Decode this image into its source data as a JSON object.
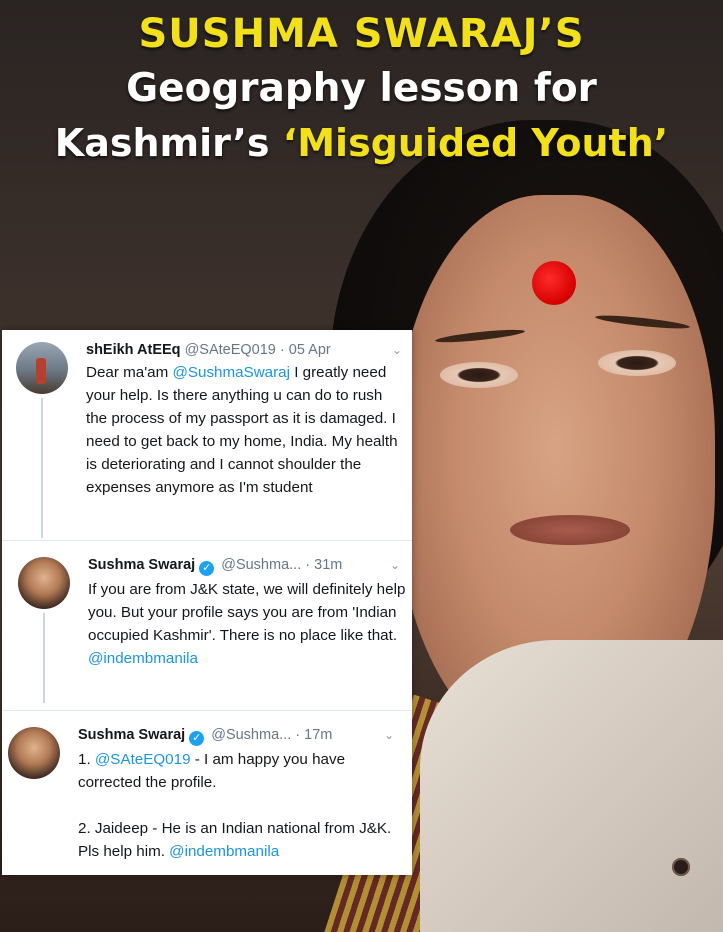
{
  "headline": {
    "line1": "SUSHMA SWARAJ’S",
    "line2": "Geography lesson for",
    "line3_prefix": "Kashmir’s",
    "line3_highlight": "‘Misguided Youth’"
  },
  "colors": {
    "headline_yellow": "#f2e11a",
    "mention_blue": "#1b95e0",
    "verified_blue": "#1da1f2",
    "bindi_red": "#d40000"
  },
  "tweets": [
    {
      "name": "shEikh AtEEq",
      "handle": "@SAteEQ019",
      "separator": "·",
      "time": "05 Apr",
      "verified": false,
      "body": {
        "t1": "Dear ma'am ",
        "m1": "@SushmaSwaraj",
        "t2": " I greatly need your help. Is there anything u can do to rush the process of my passport as it is damaged. I need to get back to my home, India. My health is deteriorating and I cannot shoulder the expenses anymore as I'm student"
      }
    },
    {
      "name": "Sushma Swaraj",
      "handle": "@Sushma...",
      "separator": "·",
      "time": "31m",
      "verified": true,
      "body": {
        "t1": "If you are from J&K state, we will definitely help you. But your profile says you are from 'Indian occupied Kashmir'. There is no place like that.",
        "m1": "@indembmanila"
      }
    },
    {
      "name": "Sushma Swaraj",
      "handle": "@Sushma...",
      "separator": "·",
      "time": "17m",
      "verified": true,
      "body": {
        "p1_prefix": "1. ",
        "p1_mention": "@SAteEQ019",
        "p1_text": " - I am happy you have corrected the profile.",
        "p2_text": "2. Jaideep - He is an Indian national from J&K. Pls help him. ",
        "p2_mention": "@indembmanila"
      }
    }
  ],
  "icons": {
    "caret": "chevron-down-icon",
    "verified": "verified-badge-icon",
    "verified_glyph": "✓"
  }
}
